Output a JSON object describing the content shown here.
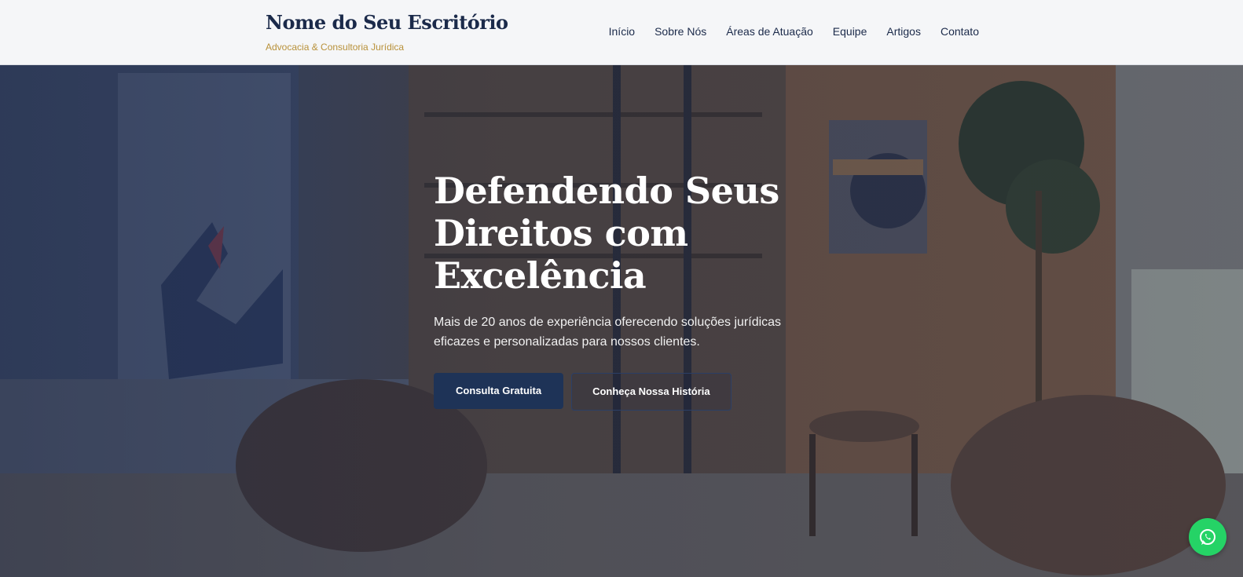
{
  "header": {
    "brand_name": "Nome do Seu Escritório",
    "brand_tagline": "Advocacia & Consultoria Jurídica",
    "nav": [
      {
        "label": "Início"
      },
      {
        "label": "Sobre Nós"
      },
      {
        "label": "Áreas de Atuação"
      },
      {
        "label": "Equipe"
      },
      {
        "label": "Artigos"
      },
      {
        "label": "Contato"
      }
    ]
  },
  "hero": {
    "title_line1": "Defendendo Seus",
    "title_line2": "Direitos com",
    "title_line3": "Excelência",
    "subtitle": "Mais de 20 anos de experiência oferecendo soluções jurídicas eficazes e personalizadas para nossos clientes.",
    "primary_button": "Consulta Gratuita",
    "secondary_button": "Conheça Nossa História"
  },
  "floating": {
    "whatsapp_icon": "whatsapp-icon"
  },
  "colors": {
    "brand_navy": "#1b2a4a",
    "accent_gold": "#b8913a",
    "button_navy": "#1e3357",
    "whatsapp_green": "#25d366"
  }
}
